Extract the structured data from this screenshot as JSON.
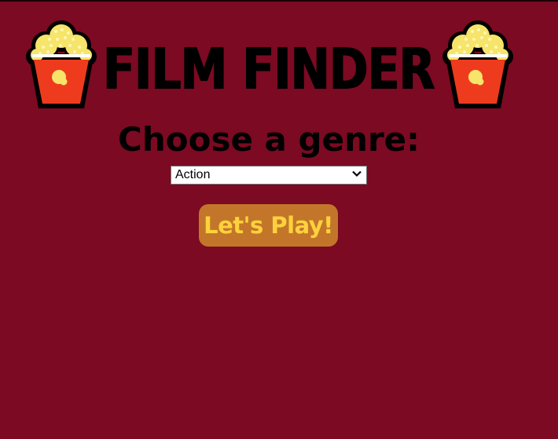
{
  "header": {
    "title": "FILM FINDER",
    "left_icon": "popcorn-icon",
    "right_icon": "popcorn-icon"
  },
  "genre": {
    "label": "Choose a genre:",
    "selected": "Action"
  },
  "play_button": {
    "label": "Let's Play!"
  },
  "colors": {
    "background": "#7b0a22",
    "button_bg": "#c3762a",
    "button_text": "#fdd23c",
    "title": "#000000"
  }
}
